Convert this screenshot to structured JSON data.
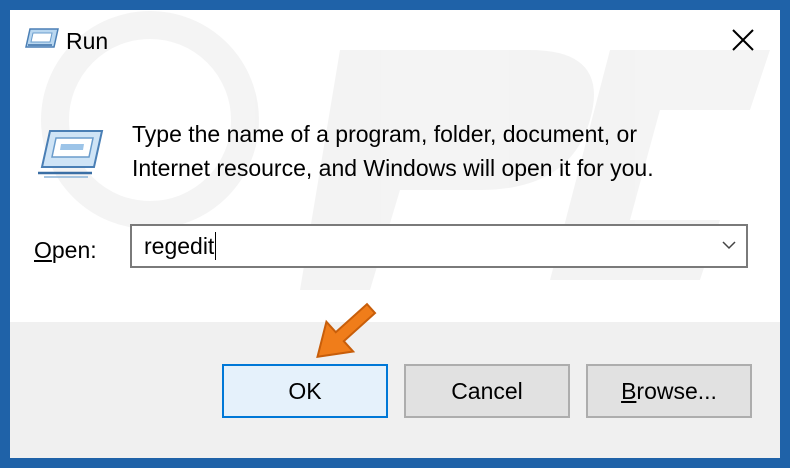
{
  "window": {
    "title": "Run",
    "icon": "run-app-icon",
    "close_icon": "close-icon"
  },
  "body": {
    "icon": "run-app-icon-large",
    "description_line1": "Type the name of a program, folder, document, or",
    "description_line2": "Internet resource, and Windows will open it for you."
  },
  "open_field": {
    "label_mnemonic": "O",
    "label_rest": "pen:",
    "value": "regedit",
    "dropdown_icon": "chevron-down-icon"
  },
  "buttons": {
    "ok": "OK",
    "cancel": "Cancel",
    "browse_mnemonic": "B",
    "browse_rest": "rowse..."
  },
  "annotation": {
    "pointer": "orange-arrow-icon",
    "color": "#f07d1a"
  },
  "colors": {
    "frame": "#1f62a8",
    "ok_border": "#0078d7",
    "footer": "#f0f0f0"
  }
}
